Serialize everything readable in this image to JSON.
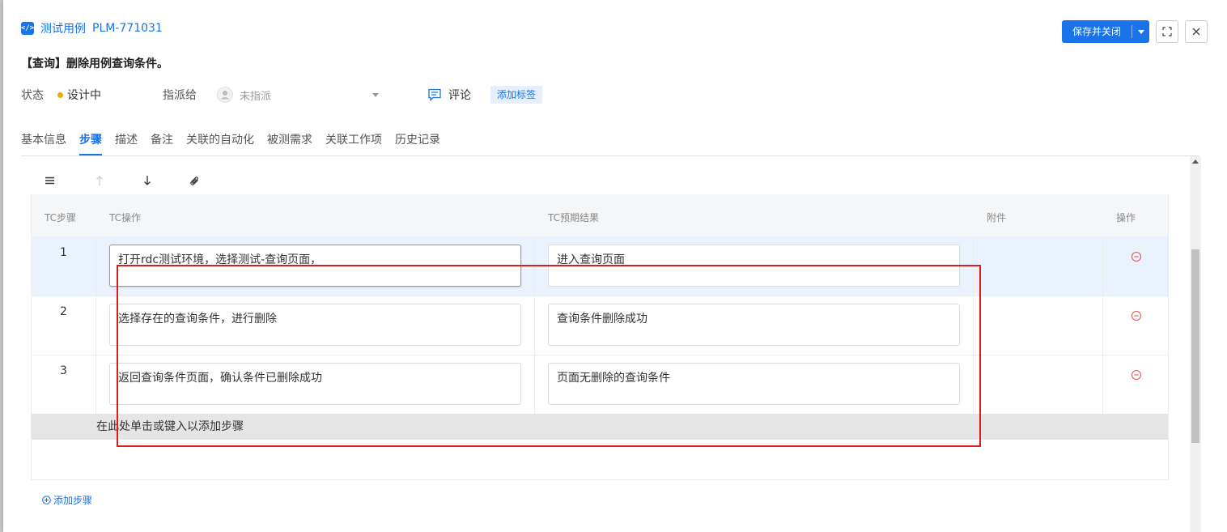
{
  "header": {
    "type_label": "测试用例",
    "case_id": "PLM-771031"
  },
  "actions": {
    "save_close_label": "保存并关闭"
  },
  "case_title": "【查询】删除用例查询条件。",
  "meta": {
    "status_label": "状态",
    "status_value": "设计中",
    "assignee_label": "指派给",
    "assignee_value": "未指派",
    "comment_label": "评论",
    "add_tag_label": "添加标签"
  },
  "tabs": [
    {
      "label": "基本信息"
    },
    {
      "label": "步骤"
    },
    {
      "label": "描述"
    },
    {
      "label": "备注"
    },
    {
      "label": "关联的自动化"
    },
    {
      "label": "被测需求"
    },
    {
      "label": "关联工作项"
    },
    {
      "label": "历史记录"
    }
  ],
  "table": {
    "columns": [
      "TC步骤",
      "TC操作",
      "TC预期结果",
      "附件",
      "操作"
    ],
    "rows": [
      {
        "num": "1",
        "action": "打开rdc测试环境，选择测试-查询页面，",
        "expected": "进入查询页面"
      },
      {
        "num": "2",
        "action": "选择存在的查询条件，进行删除",
        "expected": "查询条件删除成功"
      },
      {
        "num": "3",
        "action": "返回查询条件页面，确认条件已删除成功",
        "expected": "页面无删除的查询条件"
      }
    ],
    "add_row_hint": "在此处单击或键入以添加步骤"
  },
  "add_step_label": "添加步骤",
  "colors": {
    "accent": "#1a73e8",
    "status_dot": "#f7a600",
    "highlight": "#d81e1e",
    "remove": "#e5584f"
  }
}
